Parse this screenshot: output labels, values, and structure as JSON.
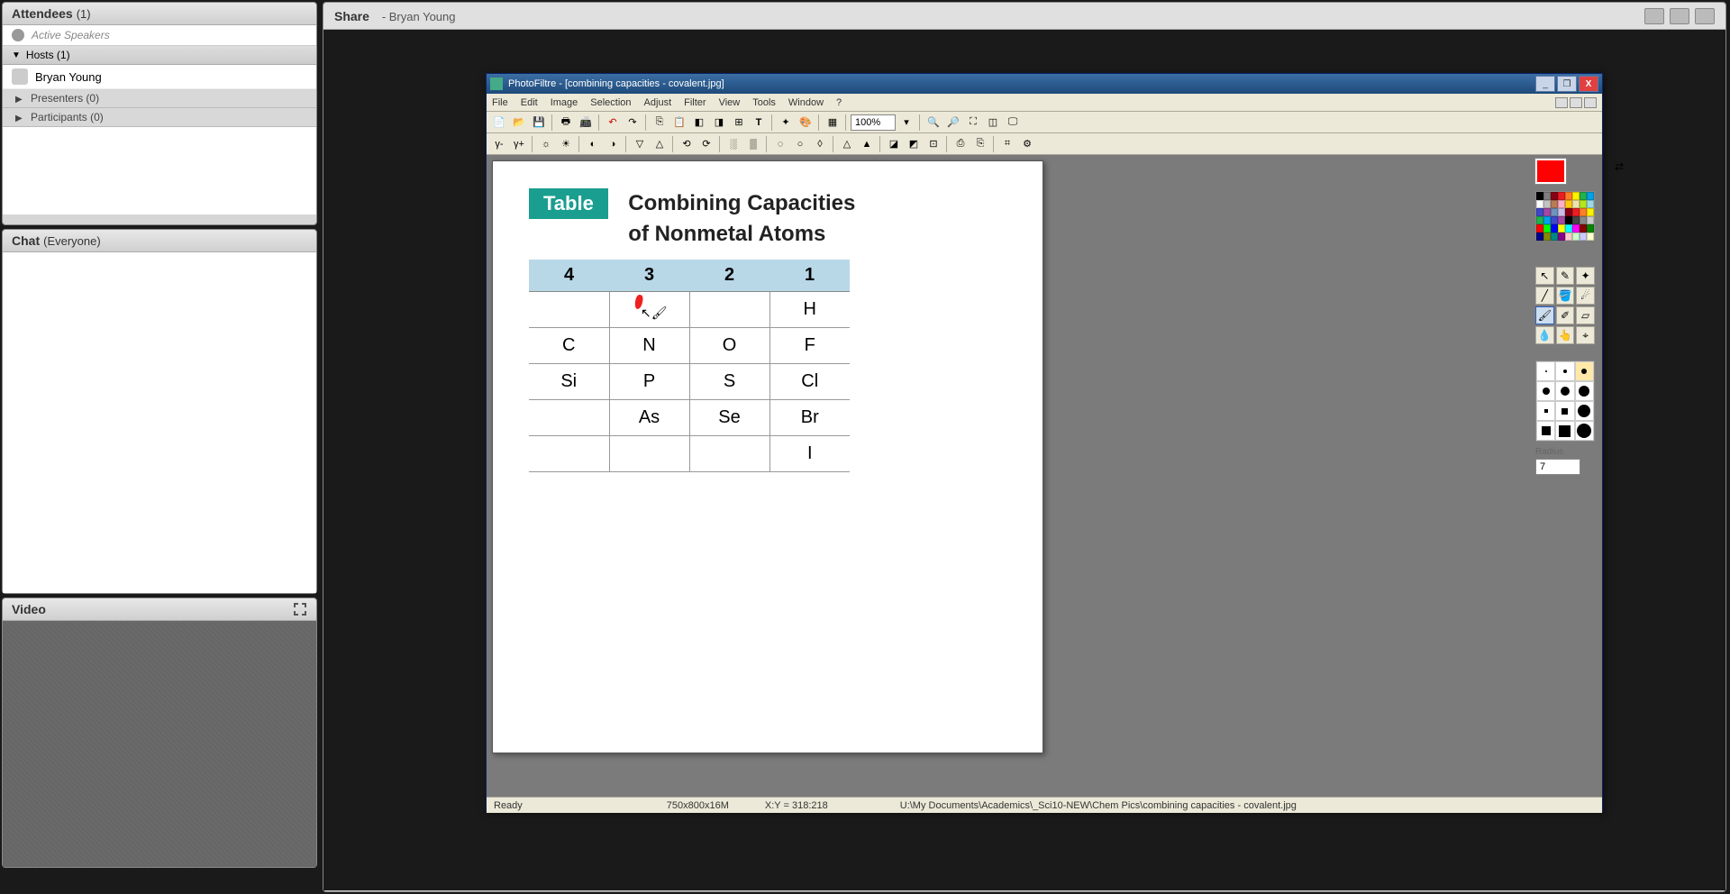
{
  "sidebar": {
    "attendees": {
      "title": "Attendees",
      "count": "(1)"
    },
    "active_speakers": "Active Speakers",
    "hosts": {
      "label": "Hosts (1)"
    },
    "host_person": "Bryan Young",
    "presenters": "Presenters (0)",
    "participants": "Participants (0)",
    "chat": {
      "title": "Chat",
      "scope": "(Everyone)"
    },
    "video": {
      "title": "Video"
    }
  },
  "share": {
    "title": "Share",
    "presenter": "- Bryan Young"
  },
  "pf": {
    "title": "PhotoFiltre - [combining capacities - covalent.jpg]",
    "menu": [
      "File",
      "Edit",
      "Image",
      "Selection",
      "Adjust",
      "Filter",
      "View",
      "Tools",
      "Window",
      "?"
    ],
    "zoom": "100%",
    "status_ready": "Ready",
    "status_dim": "750x800x16M",
    "status_xy": "X:Y = 318:218",
    "status_path": "U:\\My Documents\\Academics\\_Sci10-NEW\\Chem Pics\\combining capacities - covalent.jpg",
    "radius_label": "Radius",
    "radius_value": "7"
  },
  "doc": {
    "badge": "Table",
    "title_line1": "Combining Capacities",
    "title_line2": "of Nonmetal Atoms",
    "headers": [
      "4",
      "3",
      "2",
      "1"
    ],
    "rows": [
      [
        "",
        "",
        "",
        "H"
      ],
      [
        "C",
        "N",
        "O",
        "F"
      ],
      [
        "Si",
        "P",
        "S",
        "Cl"
      ],
      [
        "",
        "As",
        "Se",
        "Br"
      ],
      [
        "",
        "",
        "",
        "I"
      ]
    ]
  },
  "palette_colors": [
    "#000000",
    "#7f7f7f",
    "#880015",
    "#ed1c24",
    "#ff7f27",
    "#fff200",
    "#22b14c",
    "#00a2e8",
    "#ffffff",
    "#c3c3c3",
    "#b97a57",
    "#ffaec9",
    "#ffc90e",
    "#efe4b0",
    "#b5e61d",
    "#99d9ea",
    "#3f48cc",
    "#a349a4",
    "#7092be",
    "#c8bfe7",
    "#880015",
    "#ed1c24",
    "#ff7f27",
    "#fff200",
    "#22b14c",
    "#00a2e8",
    "#3f48cc",
    "#a349a4",
    "#000",
    "#444",
    "#888",
    "#ccc",
    "#f00",
    "#0f0",
    "#00f",
    "#ff0",
    "#0ff",
    "#f0f",
    "#800",
    "#080",
    "#008",
    "#880",
    "#088",
    "#808",
    "#fcc",
    "#cfc",
    "#ccf",
    "#ffc"
  ]
}
